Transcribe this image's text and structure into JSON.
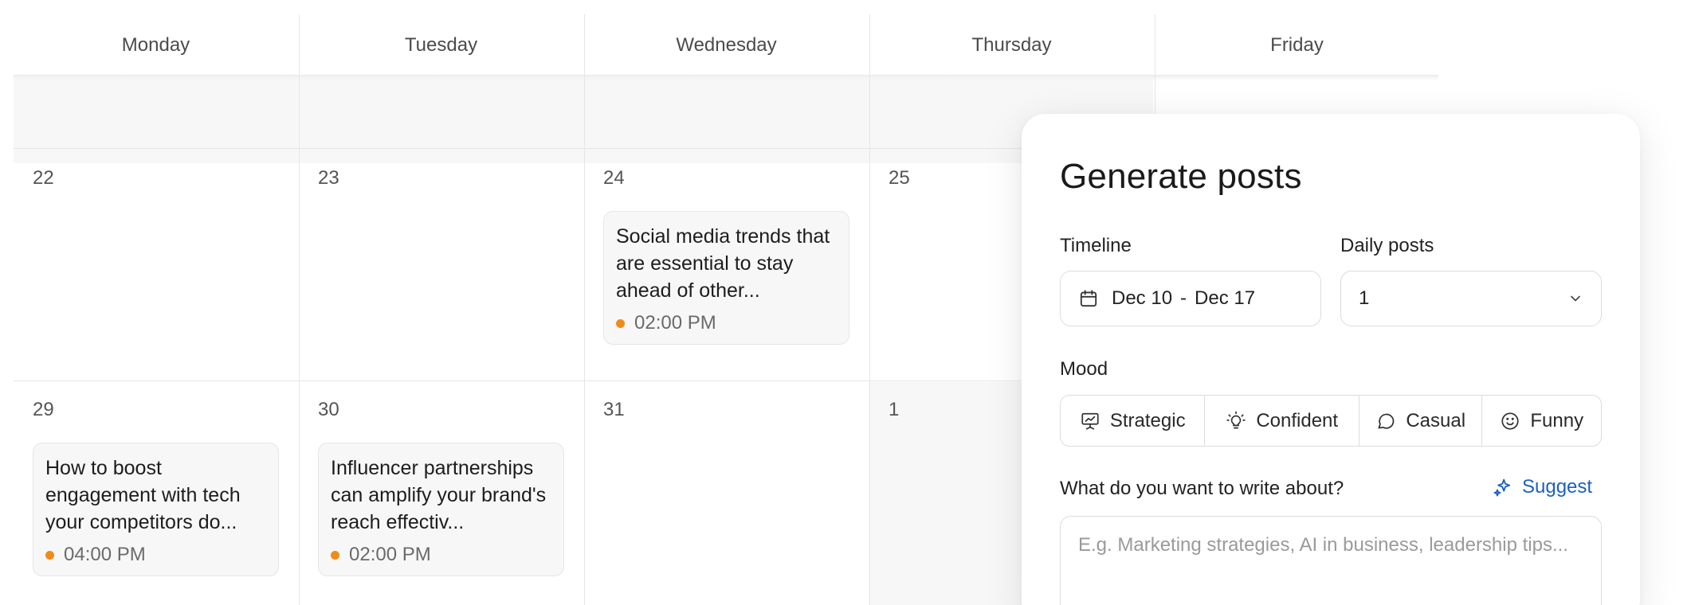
{
  "calendar": {
    "days": [
      "Monday",
      "Tuesday",
      "Wednesday",
      "Thursday",
      "Friday"
    ],
    "dates": {
      "row1": [
        "22",
        "23",
        "24",
        "25"
      ],
      "row2": [
        "29",
        "30",
        "31",
        "1"
      ]
    },
    "posts": [
      {
        "title": "Social media trends that are essential to stay ahead of other...",
        "time": "02:00 PM"
      },
      {
        "title": "How to boost engagement with tech your competitors do...",
        "time": "04:00 PM"
      },
      {
        "title": "Influencer partnerships can amplify your brand's reach effectiv...",
        "time": "02:00 PM"
      }
    ],
    "accent_dot_color": "#f28a1a"
  },
  "panel": {
    "title": "Generate posts",
    "timeline": {
      "label": "Timeline",
      "start": "Dec 10",
      "separator": "-",
      "end": "Dec 17",
      "icon": "calendar-icon"
    },
    "daily_posts": {
      "label": "Daily posts",
      "value": "1",
      "icon": "chevron-down-icon"
    },
    "mood": {
      "label": "Mood",
      "options": [
        {
          "label": "Strategic",
          "icon": "presentation-icon"
        },
        {
          "label": "Confident",
          "icon": "lightbulb-icon"
        },
        {
          "label": "Casual",
          "icon": "chat-bubble-icon"
        },
        {
          "label": "Funny",
          "icon": "smiley-icon"
        }
      ]
    },
    "topic": {
      "label": "What do you want to write about?",
      "placeholder": "E.g. Marketing strategies, AI in business, leadership tips...",
      "suggest_label": "Suggest",
      "suggest_icon": "sparkle-icon"
    },
    "link_color": "#1f5fbf"
  }
}
